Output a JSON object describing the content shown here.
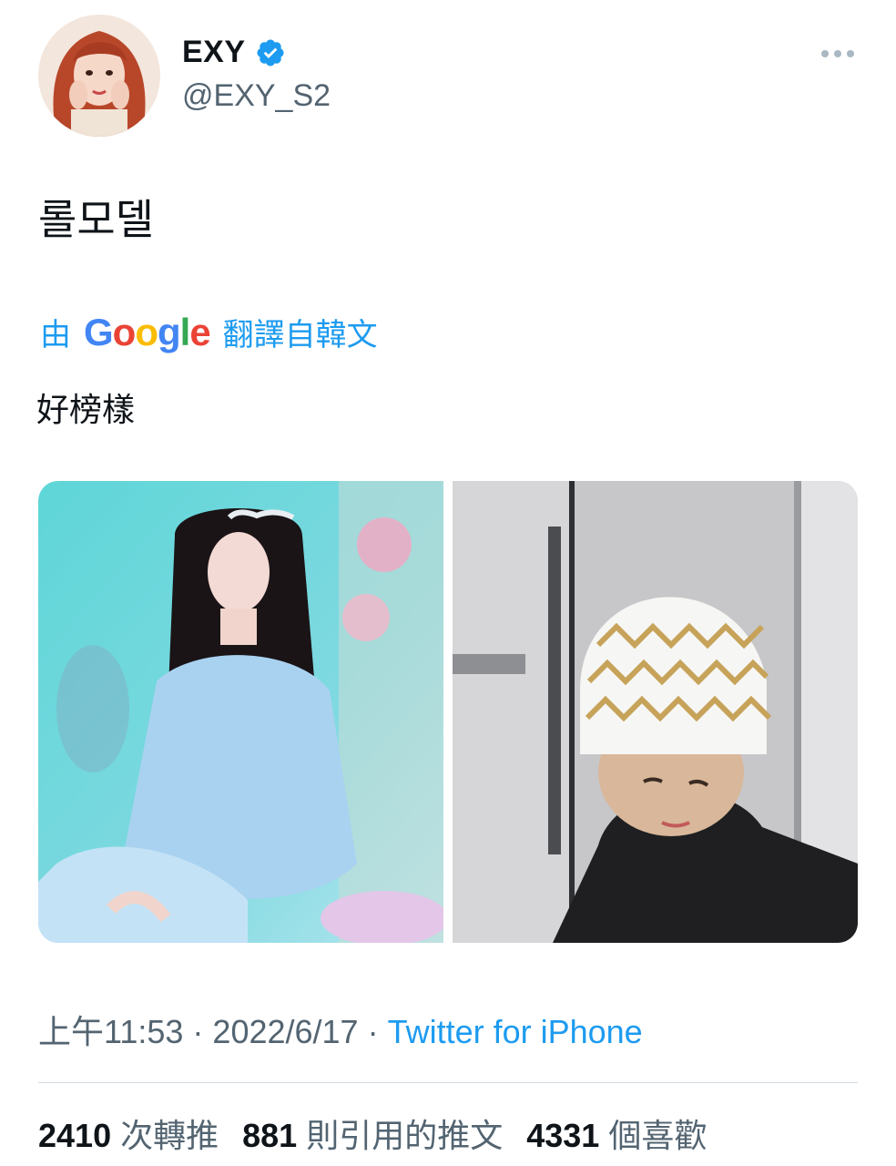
{
  "author": {
    "display_name": "EXY",
    "handle": "@EXY_S2",
    "avatar_icon": "profile-avatar",
    "verified_icon": "verified-badge-icon"
  },
  "menu": {
    "more_icon": "more-options-icon"
  },
  "tweet": {
    "text": "롤모델"
  },
  "translation": {
    "prefix": "由",
    "google_parts": [
      "G",
      "o",
      "o",
      "g",
      "l",
      "e"
    ],
    "suffix": "翻譯自韓文",
    "text": "好榜樣"
  },
  "media": {
    "count": 2,
    "images": [
      "photo-blue-dress",
      "photo-fruit-net-hat"
    ]
  },
  "meta": {
    "time": "上午11:53",
    "sep1": " · ",
    "date": "2022/6/17",
    "sep2": " · ",
    "source": "Twitter for iPhone"
  },
  "stats": {
    "retweets_count": "2410",
    "retweets_label": "次轉推",
    "quotes_count": "881",
    "quotes_label": "則引用的推文",
    "likes_count": "4331",
    "likes_label": "個喜歡"
  },
  "colors": {
    "accent": "#1d9bf0",
    "text": "#0f1419",
    "secondary": "#536471",
    "divider": "#cfd9de",
    "google_blue": "#4285f4",
    "google_red": "#ea4335",
    "google_yellow": "#fbbc05",
    "google_green": "#34a853"
  }
}
